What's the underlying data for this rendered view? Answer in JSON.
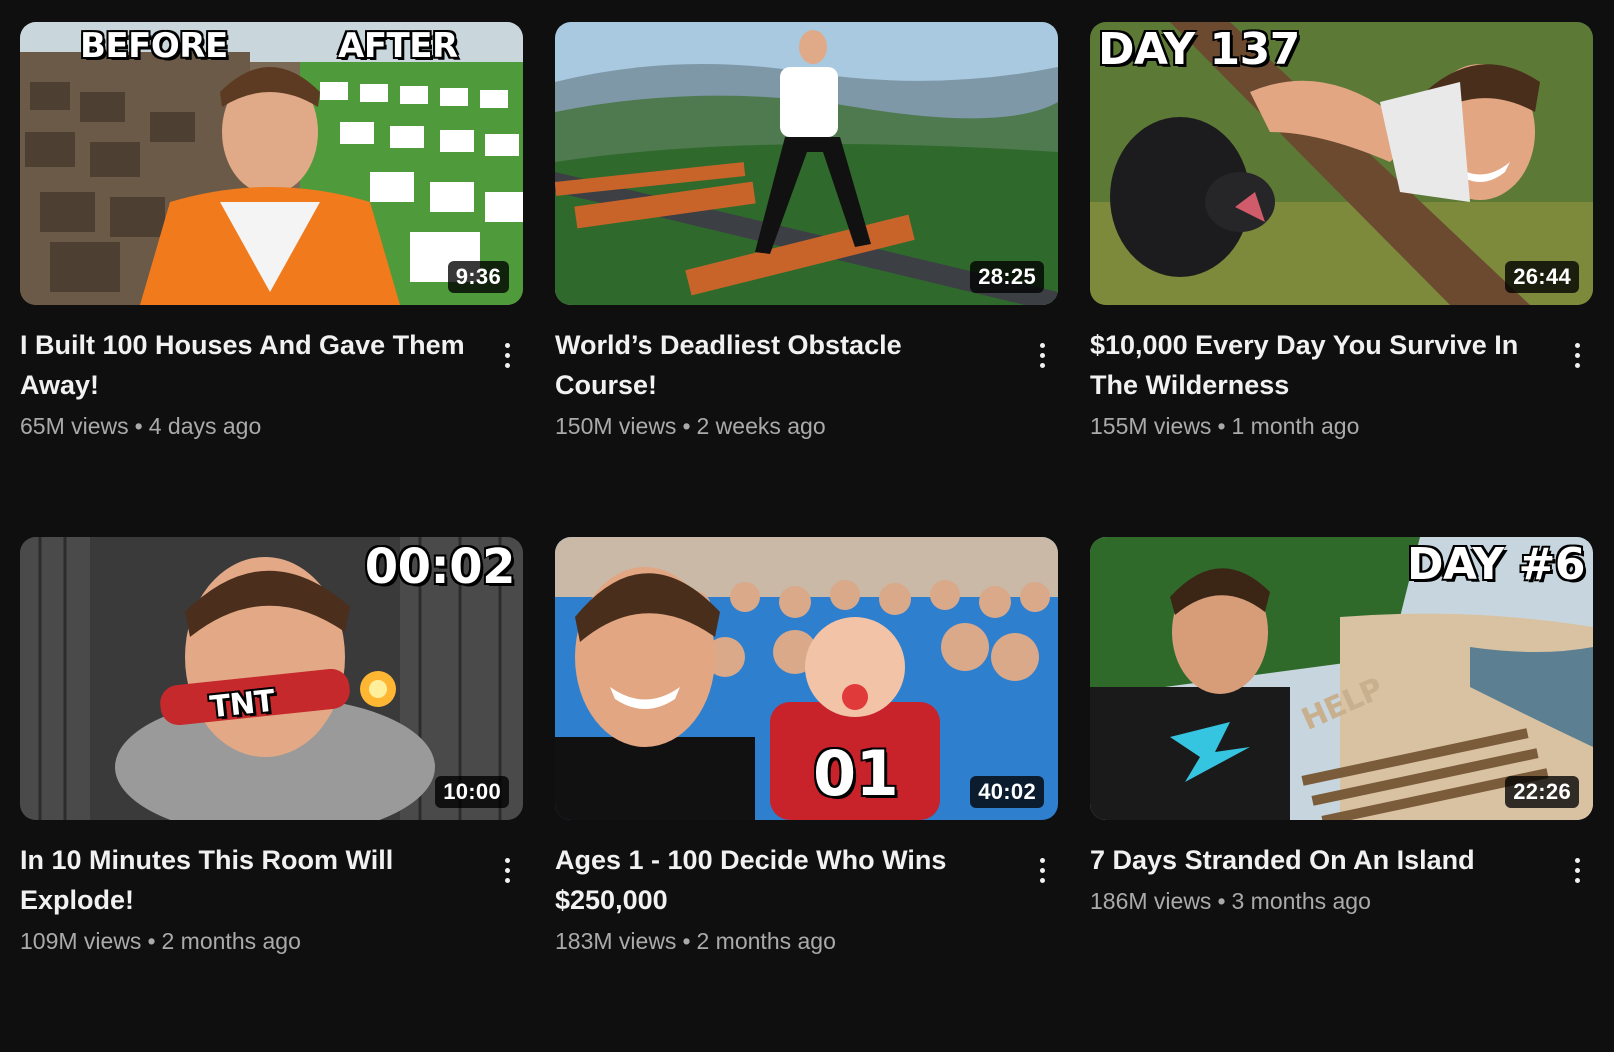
{
  "videos": [
    {
      "title": "I Built 100 Houses And Gave Them Away!",
      "views": "65M views",
      "age": "4 days ago",
      "duration": "9:36",
      "overlay_left": "BEFORE",
      "overlay_right": "AFTER"
    },
    {
      "title": "World’s Deadliest Obstacle Course!",
      "views": "150M views",
      "age": "2 weeks ago",
      "duration": "28:25"
    },
    {
      "title": "$10,000 Every Day You Survive In The Wilderness",
      "views": "155M views",
      "age": "1 month ago",
      "duration": "26:44",
      "overlay": "DAY 137"
    },
    {
      "title": "In 10 Minutes This Room Will Explode!",
      "views": "109M views",
      "age": "2 months ago",
      "duration": "10:00",
      "overlay": "00:02",
      "overlay_tnt": "TNT"
    },
    {
      "title": "Ages 1 - 100 Decide Who Wins $250,000",
      "views": "183M views",
      "age": "2 months ago",
      "duration": "40:02",
      "overlay": "01"
    },
    {
      "title": "7 Days Stranded On An Island",
      "views": "186M views",
      "age": "3 months ago",
      "duration": "22:26",
      "overlay": "DAY #6",
      "overlay_sand": "HELP"
    }
  ],
  "separator": "•",
  "colors": {
    "background": "#0f0f0f",
    "title": "#f1f1f1",
    "meta": "#aaaaaa"
  }
}
